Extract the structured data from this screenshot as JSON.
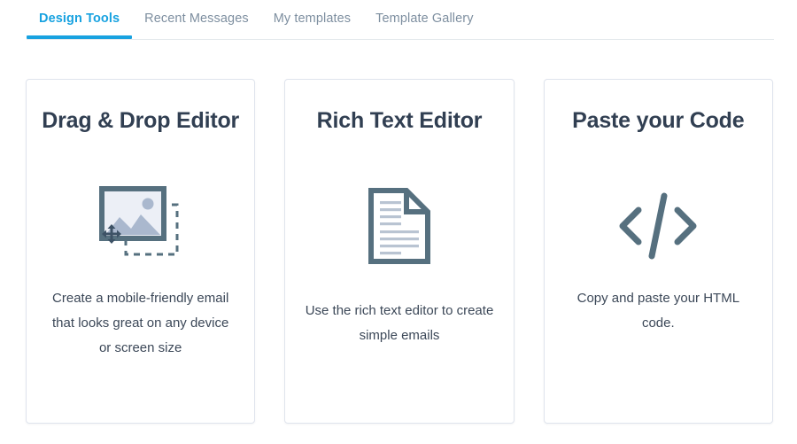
{
  "tabs": [
    {
      "label": "Design Tools",
      "active": true
    },
    {
      "label": "Recent Messages",
      "active": false
    },
    {
      "label": "My templates",
      "active": false
    },
    {
      "label": "Template Gallery",
      "active": false
    }
  ],
  "cards": [
    {
      "title": "Drag & Drop Editor",
      "icon": "image-drag-drop-icon",
      "description": "Create a mobile-friendly email that looks great on any device or screen size"
    },
    {
      "title": "Rich Text Editor",
      "icon": "document-icon",
      "description": "Use the rich text editor to create simple emails"
    },
    {
      "title": "Paste your Code",
      "icon": "code-brackets-icon",
      "description": "Copy and paste your HTML code."
    }
  ],
  "colors": {
    "accent_blue": "#18a2e0",
    "tab_inactive": "#7e8fa0",
    "card_title": "#313f52",
    "card_border": "#dfe4ed",
    "icon_dark": "#56707f",
    "icon_light": "#aab8ce",
    "icon_fill": "#eceff6",
    "body_text": "#3c4858"
  }
}
